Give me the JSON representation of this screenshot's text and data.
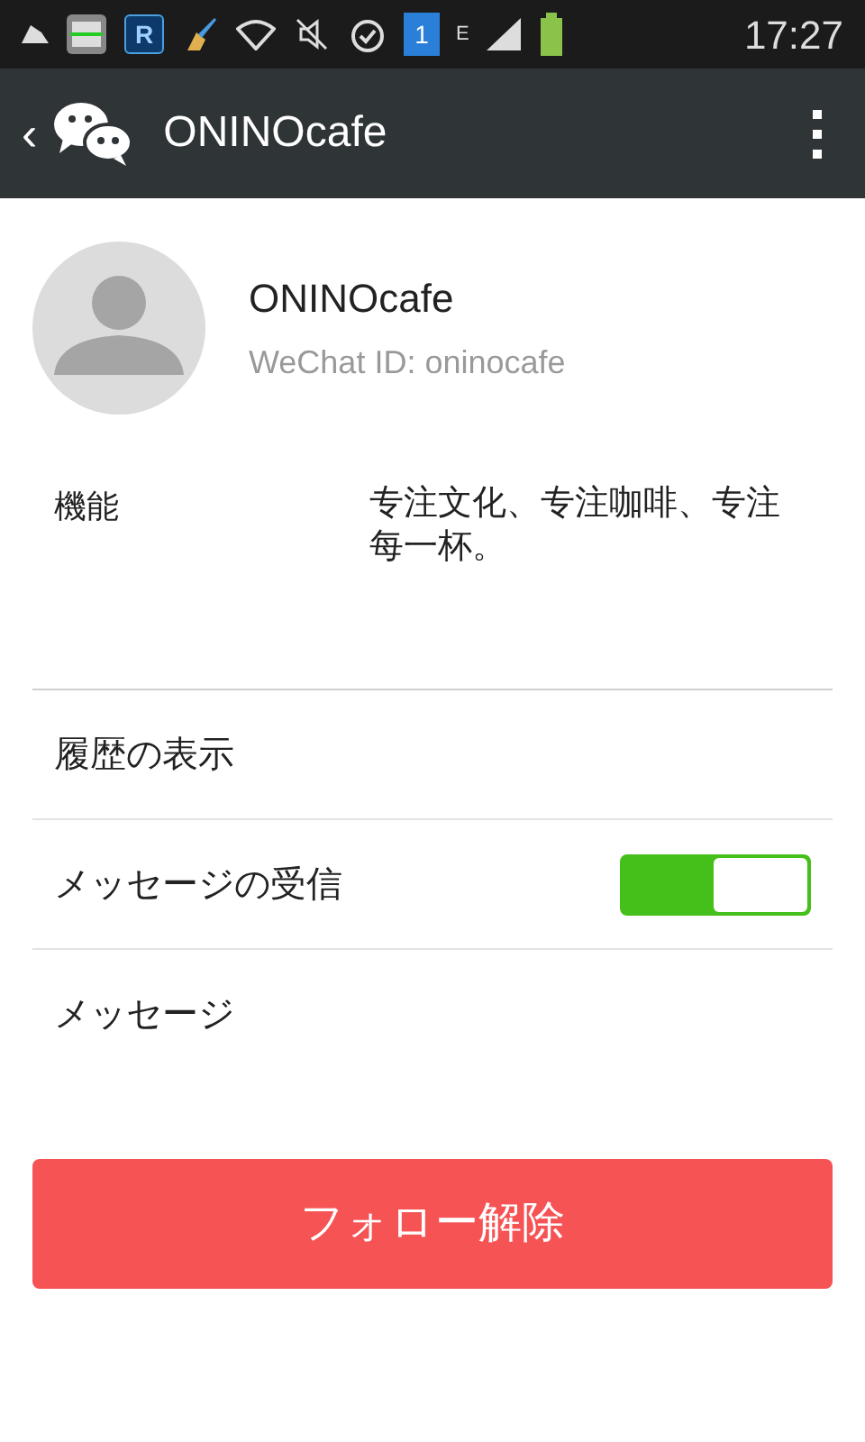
{
  "status_bar": {
    "app_badge": "R",
    "notification_count": "1",
    "network_type": "E",
    "time": "17:27"
  },
  "header": {
    "back": "‹",
    "title": "ONINOcafe"
  },
  "profile": {
    "name": "ONINOcafe",
    "id_line": "WeChat ID: oninocafe"
  },
  "feature": {
    "label": "機能",
    "value": "专注文化、专注咖啡、专注每一杯。"
  },
  "rows": [
    {
      "kind": "link",
      "label": "履歴の表示"
    },
    {
      "kind": "toggle",
      "label": "メッセージの受信",
      "on": true
    },
    {
      "kind": "link",
      "label": "メッセージ"
    }
  ],
  "unfollow_button": "フォロー解除"
}
